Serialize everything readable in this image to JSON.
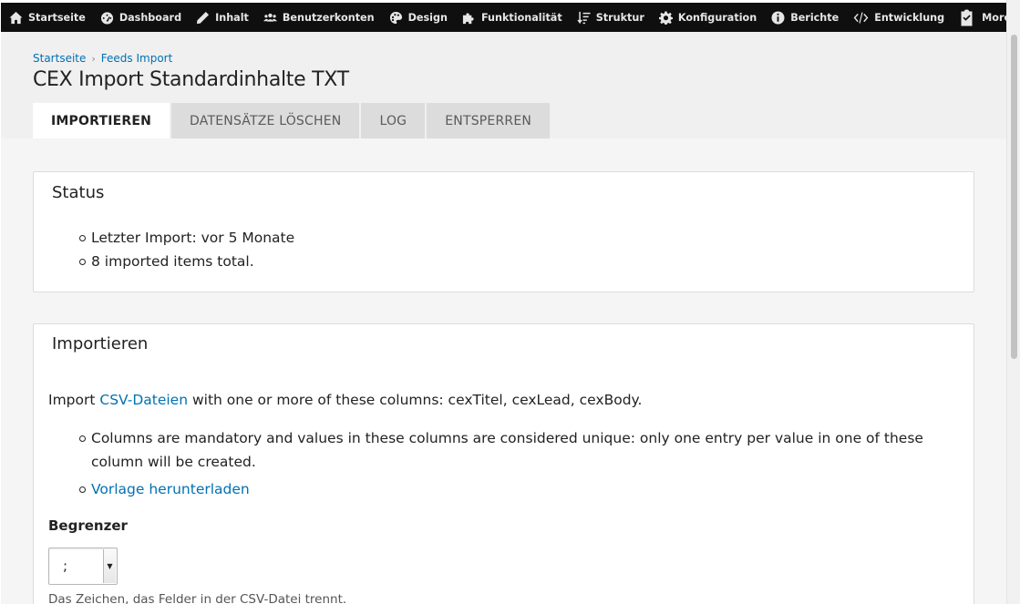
{
  "toolbar": {
    "items": [
      {
        "label": "Startseite",
        "icon": "home-icon"
      },
      {
        "label": "Dashboard",
        "icon": "dashboard-icon"
      },
      {
        "label": "Inhalt",
        "icon": "pencil-icon"
      },
      {
        "label": "Benutzerkonten",
        "icon": "users-icon"
      },
      {
        "label": "Design",
        "icon": "palette-icon"
      },
      {
        "label": "Funktionalität",
        "icon": "puzzle-icon"
      },
      {
        "label": "Struktur",
        "icon": "sort-icon"
      },
      {
        "label": "Konfiguration",
        "icon": "gear-icon"
      },
      {
        "label": "Berichte",
        "icon": "info-icon"
      },
      {
        "label": "Entwicklung",
        "icon": "code-icon"
      }
    ],
    "more_tasks": "More tasks"
  },
  "breadcrumb": [
    "Startseite",
    "Feeds Import"
  ],
  "page_title": "CEX Import Standardinhalte TXT",
  "tabs": [
    {
      "label": "IMPORTIEREN",
      "active": true
    },
    {
      "label": "DATENSÄTZE LÖSCHEN",
      "active": false
    },
    {
      "label": "LOG",
      "active": false
    },
    {
      "label": "ENTSPERREN",
      "active": false
    }
  ],
  "status": {
    "title": "Status",
    "items": [
      "Letzter Import: vor 5 Monate",
      "8 imported items total."
    ]
  },
  "importer": {
    "title": "Importieren",
    "intro_prefix": "Import ",
    "intro_link": "CSV-Dateien",
    "intro_suffix": " with one or more of these columns: cexTitel, cexLead, cexBody.",
    "bullet_text": "Columns are mandatory and values in these columns are considered unique: only one entry per value in one of these column will be created.",
    "template_link": "Vorlage herunterladen",
    "delimiter_label": "Begrenzer",
    "delimiter_value": ";",
    "delimiter_help": "Das Zeichen, das Felder in der CSV-Datei trennt."
  }
}
